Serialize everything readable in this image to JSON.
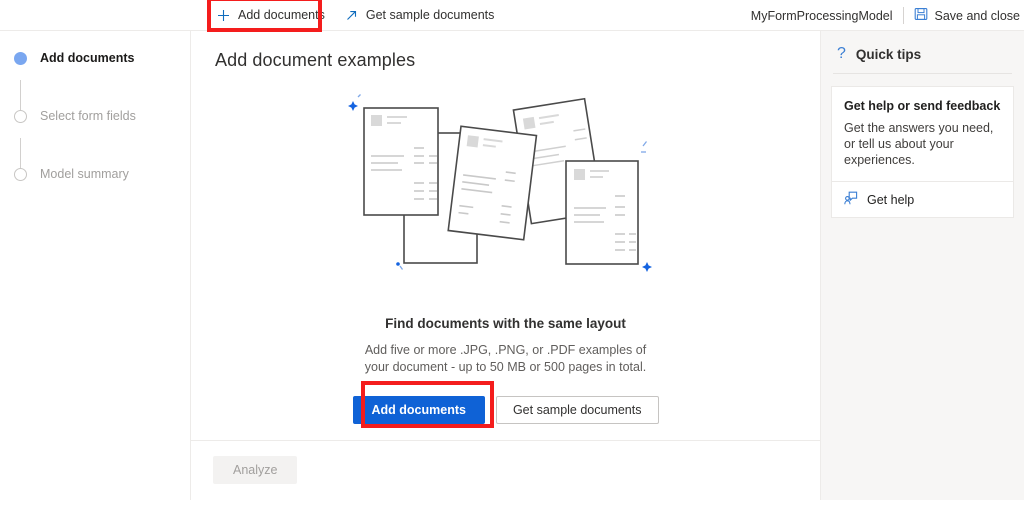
{
  "commandbar": {
    "add_documents": {
      "label": "Add documents",
      "icon": "plus-icon"
    },
    "get_sample_documents": {
      "label": "Get sample documents",
      "icon": "diagonal-arrow-icon"
    },
    "model_name": "MyFormProcessingModel",
    "save_and_close": {
      "label": "Save and close",
      "icon": "save-disk-icon"
    }
  },
  "stepper": {
    "steps": [
      {
        "label": "Add documents",
        "state": "active"
      },
      {
        "label": "Select form fields",
        "state": "pending"
      },
      {
        "label": "Model summary",
        "state": "pending"
      }
    ]
  },
  "main": {
    "page_title": "Add document examples",
    "cta": {
      "title": "Find documents with the same layout",
      "description": "Add five or more .JPG, .PNG, or .PDF examples of your document - up to 50 MB or 500 pages in total.",
      "primary_button": "Add documents",
      "secondary_button": "Get sample documents"
    },
    "analyze_button": "Analyze"
  },
  "tips": {
    "header": "Quick tips",
    "header_icon": "question-mark-icon",
    "card": {
      "title": "Get help or send feedback",
      "description": "Get the answers you need, or tell us about your experiences.",
      "link_label": "Get help",
      "link_icon": "feedback-person-icon"
    }
  },
  "colors": {
    "accent_blue": "#0f6cbd",
    "primary_button": "#0f62d6",
    "step_active": "#7aa7f0",
    "annotation_red": "#f41d1d",
    "panel_background": "#f7f6f5"
  }
}
